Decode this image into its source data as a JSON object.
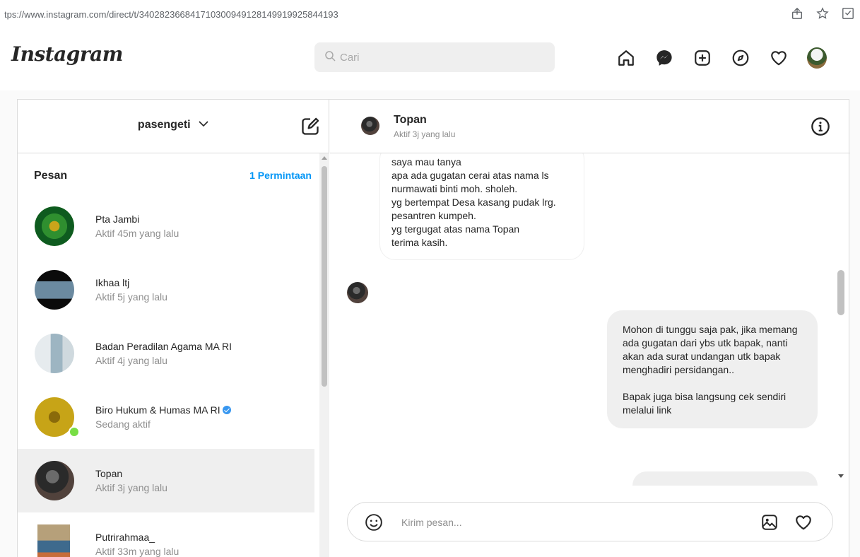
{
  "browser": {
    "url": "tps://www.instagram.com/direct/t/340282366841710300949128149919925844193"
  },
  "header": {
    "logo_text": "Instagram",
    "search_placeholder": "Cari",
    "nav_icons": [
      "home-icon",
      "messenger-icon",
      "new-post-icon",
      "explore-icon",
      "activity-heart-icon",
      "profile-avatar"
    ]
  },
  "inbox": {
    "account_name": "pasengeti",
    "list_title": "Pesan",
    "requests_label": "1 Permintaan",
    "threads": [
      {
        "name": "Pta Jambi",
        "status": "Aktif 45m yang lalu",
        "avatar": "av-pta",
        "verified": false,
        "online": false,
        "active": false
      },
      {
        "name": "Ikhaa ltj",
        "status": "Aktif 5j yang lalu",
        "avatar": "av-ikhaa",
        "verified": false,
        "online": false,
        "active": false
      },
      {
        "name": "Badan Peradilan Agama MA RI",
        "status": "Aktif 4j yang lalu",
        "avatar": "av-badan",
        "verified": false,
        "online": false,
        "active": false
      },
      {
        "name": "Biro Hukum & Humas MA RI",
        "status": "Sedang aktif",
        "avatar": "av-biro",
        "verified": true,
        "online": true,
        "active": false
      },
      {
        "name": "Topan",
        "status": "Aktif 3j yang lalu",
        "avatar": "av-topan",
        "verified": false,
        "online": false,
        "active": true
      },
      {
        "name": "Putrirahmaa_",
        "status": "Aktif 33m yang lalu",
        "avatar": "av-putri",
        "verified": false,
        "online": false,
        "active": false
      }
    ]
  },
  "chat": {
    "contact_name": "Topan",
    "contact_status": "Aktif 3j yang lalu",
    "incoming_message": "saya mau tanya\napa ada gugatan cerai atas nama ls nurmawati binti moh. sholeh.\nyg bertempat Desa kasang pudak lrg. pesantren kumpeh.\nyg tergugat atas nama Topan\nterima kasih.",
    "outgoing_message": "Mohon di tunggu saja pak, jika memang ada gugatan dari ybs utk bapak, nanti akan ada surat undangan utk bapak menghadiri persidangan..\n\nBapak juga bisa langsung cek sendiri melalui link",
    "composer_placeholder": "Kirim pesan..."
  }
}
